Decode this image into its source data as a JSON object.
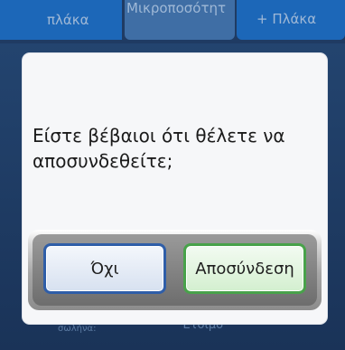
{
  "background": {
    "tabs": [
      {
        "label": "πλάκα"
      },
      {
        "label": "Μικροποσότητ"
      },
      {
        "label": "+ Πλάκα"
      }
    ],
    "status": {
      "key": "Συγκρατητήρας σωλήνα:",
      "value": "Έτοιμο"
    }
  },
  "dialog": {
    "message": "Είστε βέβαιοι ότι θέλετε να αποσυνδεθείτε;",
    "no_label": "Όχι",
    "disconnect_label": "Αποσύνδεση"
  },
  "colors": {
    "no_border": "#2f5ea8",
    "disconnect_border": "#48a24a"
  }
}
